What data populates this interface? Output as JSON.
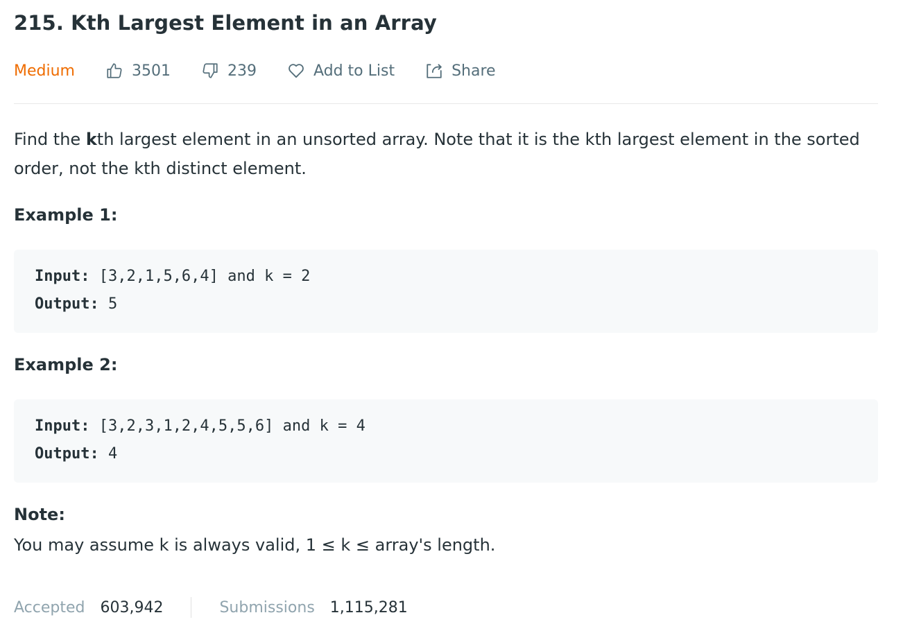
{
  "problem": {
    "title": "215. Kth Largest Element in an Array",
    "difficulty": "Medium",
    "likes": "3501",
    "dislikes": "239",
    "add_to_list_label": "Add to List",
    "share_label": "Share"
  },
  "description": {
    "part1": "Find the ",
    "bold": "k",
    "part2": "th largest element in an unsorted array. Note that it is the kth largest element in the sorted order, not the kth distinct element."
  },
  "examples": [
    {
      "title": "Example 1:",
      "input_label": "Input:",
      "input_value": " [3,2,1,5,6,4] and k = 2",
      "output_label": "Output:",
      "output_value": " 5"
    },
    {
      "title": "Example 2:",
      "input_label": "Input:",
      "input_value": " [3,2,3,1,2,4,5,5,6] and k = 4",
      "output_label": "Output:",
      "output_value": " 4"
    }
  ],
  "note": {
    "title": "Note:",
    "text": "You may assume k is always valid, 1 ≤ k ≤ array's length."
  },
  "stats": {
    "accepted_label": "Accepted",
    "accepted_value": "603,942",
    "submissions_label": "Submissions",
    "submissions_value": "1,115,281"
  },
  "colors": {
    "difficulty": "#ef6c00",
    "meta_text": "#546e7a",
    "code_bg": "#f7f9fa"
  }
}
